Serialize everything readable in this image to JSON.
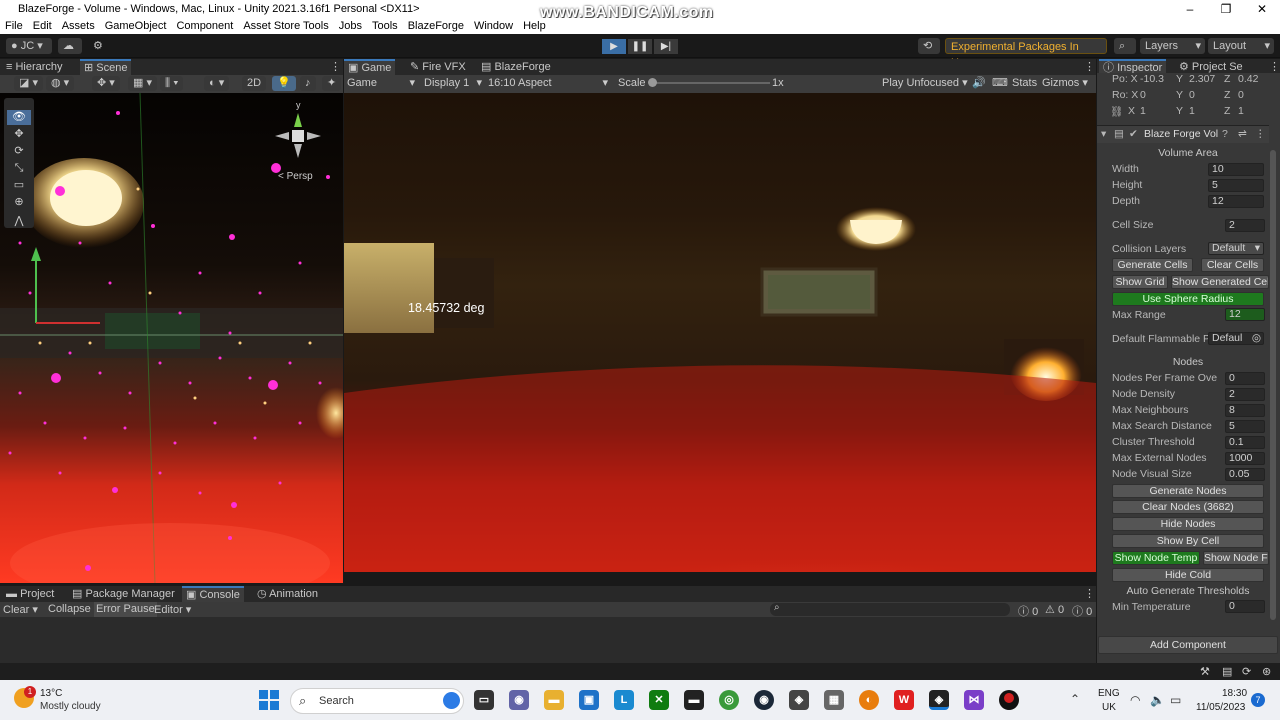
{
  "window": {
    "title": "BlazeForge - Volume - Windows, Mac, Linux - Unity 2021.3.16f1 Personal <DX11>",
    "controls": [
      "–",
      "❐",
      "✕"
    ],
    "watermark": "www.BANDICAM.com"
  },
  "menu": [
    "File",
    "Edit",
    "Assets",
    "GameObject",
    "Component",
    "Asset Store Tools",
    "Jobs",
    "Tools",
    "BlazeForge",
    "Window",
    "Help"
  ],
  "toolbar": {
    "account": "JC",
    "experimental": "Experimental Packages In Use",
    "layers": "Layers",
    "layout": "Layout"
  },
  "left_tabs": {
    "hierarchy": "Hierarchy",
    "scene": "Scene"
  },
  "scene_toolbar": {
    "mode_2d": "2D",
    "persp": "< Persp"
  },
  "gizmo_axes": {
    "y": "y"
  },
  "game_tabs": {
    "game": "Game",
    "fire_vfx": "Fire VFX",
    "blazeforge": "BlazeForge"
  },
  "game_toolbar": {
    "game_select": "Game",
    "display": "Display 1",
    "aspect": "16:10 Aspect",
    "scale_label": "Scale",
    "scale_value": "1x",
    "play_unfocused": "Play Unfocused",
    "stats": "Stats",
    "gizmos": "Gizmos"
  },
  "game_overlay": {
    "angle": "18.45732 deg"
  },
  "inspector_tabs": {
    "inspector": "Inspector",
    "project_settings": "Project Se"
  },
  "transform": {
    "position": {
      "label": "Po: X",
      "x": "-10.3",
      "y": "2.307",
      "z": "0.42"
    },
    "rotation": {
      "label": "Ro: X",
      "x": "0",
      "y": "0",
      "z": "0"
    },
    "scale": {
      "label": "X",
      "x": "1",
      "y": "1",
      "z": "1"
    }
  },
  "component": {
    "title": "Blaze Forge Vol",
    "volume_area_header": "Volume Area",
    "fields_a": [
      {
        "label": "Width",
        "value": "10"
      },
      {
        "label": "Height",
        "value": "5"
      },
      {
        "label": "Depth",
        "value": "12"
      }
    ],
    "cell_size": {
      "label": "Cell Size",
      "value": "2"
    },
    "collision_layers": {
      "label": "Collision Layers",
      "value": "Default"
    },
    "btn_generate_cells": "Generate Cells",
    "btn_clear_cells": "Clear Cells",
    "btn_show_grid": "Show Grid",
    "btn_show_generated": "Show Generated Cell",
    "btn_use_sphere": "Use Sphere Radius",
    "max_range": {
      "label": "Max Range",
      "value": "12"
    },
    "default_flammable": {
      "label": "Default Flammable Pr",
      "value": "Defaul"
    },
    "nodes_header": "Nodes",
    "node_fields": [
      {
        "label": "Nodes Per Frame Ove",
        "value": "0"
      },
      {
        "label": "Node Density",
        "value": "2"
      },
      {
        "label": "Max Neighbours",
        "value": "8"
      },
      {
        "label": "Max Search Distance",
        "value": "5"
      },
      {
        "label": "Cluster Threshold",
        "value": "0.1"
      },
      {
        "label": "Max External Nodes",
        "value": "1000"
      },
      {
        "label": "Node Visual Size",
        "value": "0.05"
      }
    ],
    "btn_generate_nodes": "Generate Nodes",
    "btn_clear_nodes": "Clear Nodes (3682)",
    "btn_hide_nodes": "Hide Nodes",
    "btn_show_by_cell": "Show By Cell",
    "btn_show_node_temp": "Show Node Temp",
    "btn_show_node_f": "Show Node Fi",
    "btn_hide_cold": "Hide Cold",
    "auto_thresholds_header": "Auto Generate Thresholds",
    "min_temp": {
      "label": "Min Temperature",
      "value": "0"
    },
    "btn_add_component": "Add Component"
  },
  "bottom_tabs": {
    "project": "Project",
    "package_manager": "Package Manager",
    "console": "Console",
    "animation": "Animation"
  },
  "console_toolbar": {
    "clear": "Clear",
    "collapse": "Collapse",
    "error_pause": "Error Pause",
    "editor": "Editor",
    "count_info": "0",
    "count_warn": "0",
    "count_err": "0"
  },
  "taskbar": {
    "weather_temp": "13°C",
    "weather_desc": "Mostly cloudy",
    "weather_badge": "1",
    "search": "Search",
    "lang1": "ENG",
    "lang2": "UK",
    "time": "18:30",
    "date": "11/05/2023",
    "notif": "7"
  }
}
